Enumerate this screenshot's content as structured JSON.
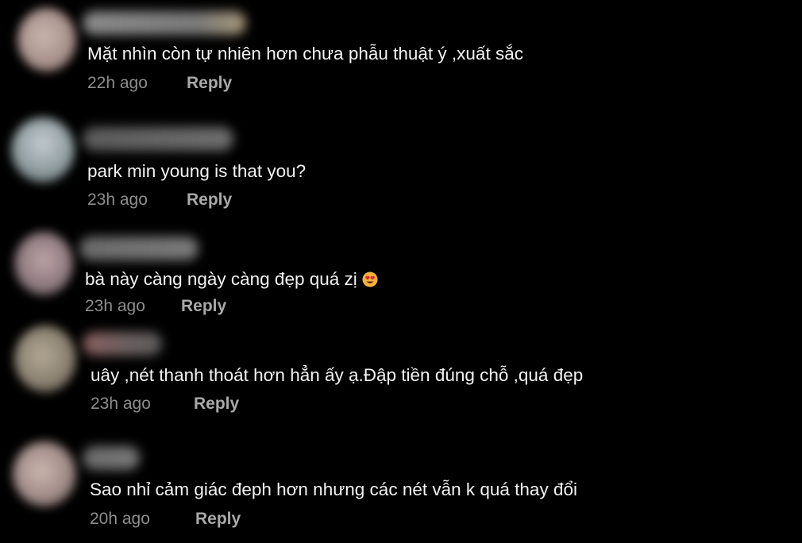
{
  "comments": [
    {
      "text": "Mặt nhìn còn tự nhiên hơn chưa phẫu thuật ý ,xuất sắc",
      "time": "22h ago",
      "reply_label": "Reply"
    },
    {
      "text": "park min young is that you?",
      "time": "23h ago",
      "reply_label": "Reply"
    },
    {
      "text": "bà này càng ngày càng đẹp quá zị",
      "time": "23h ago",
      "reply_label": "Reply",
      "emoji": "heart-eyes-emoji-icon"
    },
    {
      "text": "uây ,nét thanh thoát hơn hẳn ấy ạ.Đập tiền đúng chỗ ,quá đẹp",
      "time": "23h ago",
      "reply_label": "Reply"
    },
    {
      "text": "Sao nhỉ cảm giác đeph hơn nhưng các nét vẫn k quá thay đổi",
      "time": "20h ago",
      "reply_label": "Reply"
    }
  ],
  "colors": {
    "background": "#000000",
    "comment_text": "#f3f3f3",
    "timestamp": "#8d8d8d",
    "reply": "#a9a9a9"
  }
}
